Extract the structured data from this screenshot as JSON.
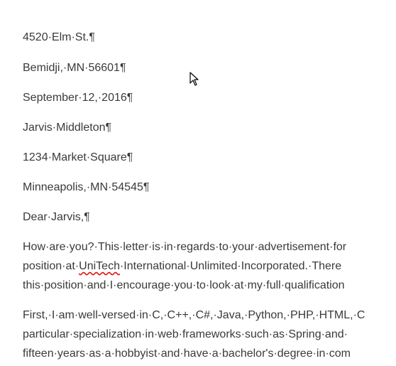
{
  "letter": {
    "sender_street": "4520·Elm·St.¶",
    "sender_city": "Bemidji,·MN·56601¶",
    "date": "September·12,·2016¶",
    "recipient_name": "Jarvis·Middleton¶",
    "recipient_street": "1234·Market·Square¶",
    "recipient_city": "Minneapolis,·MN·54545¶",
    "salutation": "Dear·Jarvis,¶",
    "para1": {
      "line1": "How·are·you?·This·letter·is·in·regards·to·your·advertisement·for",
      "line2_pre": "position·at·",
      "line2_misspelled": "UniTech",
      "line2_post": "·International·Unlimited·Incorporated.·There",
      "line3": "this·position·and·I·encourage·you·to·look·at·my·full·qualification"
    },
    "para2": {
      "line1": "First,·I·am·well-versed·in·C,·C++,·C#,·Java,·Python,·PHP,·HTML,·C",
      "line2": "particular·specialization·in·web·frameworks·such·as·Spring·and·",
      "line3": "fifteen·years·as·a·hobbyist·and·have·a·bachelor's·degree·in·com"
    }
  }
}
